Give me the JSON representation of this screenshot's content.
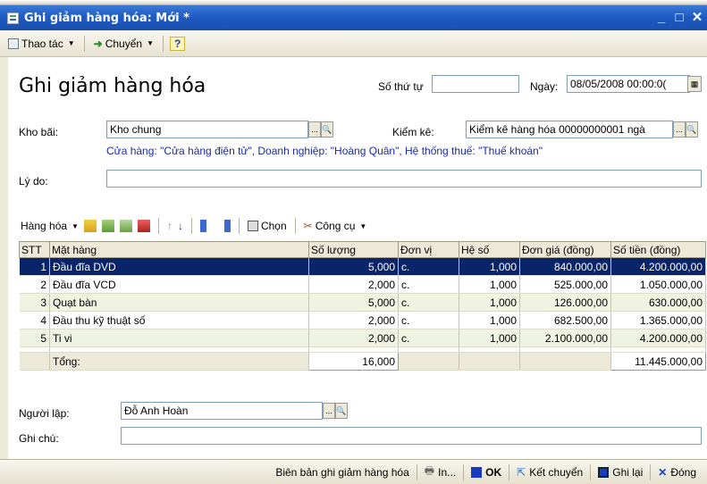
{
  "window": {
    "title": "Ghi giảm hàng hóa: Mới *",
    "minimize": "_",
    "maximize": "□",
    "close": "✕"
  },
  "toolbar": {
    "thao_tac_label": "Thao tác",
    "chuyen_label": "Chuyển",
    "help_label": "?"
  },
  "form": {
    "heading": "Ghi giảm hàng hóa",
    "so_thu_tu_label": "Số thứ tự",
    "so_thu_tu_value": "",
    "ngay_label": "Ngày:",
    "ngay_value": "08/05/2008 00:00:0(",
    "kho_bai_label": "Kho bãi:",
    "kho_bai_value": "Kho chung",
    "kiem_ke_label": "Kiểm kê:",
    "kiem_ke_value": "Kiểm kê hàng hóa 00000000001 ngà",
    "info_line": "Cửa hàng: \"Cửa hàng điện tử\", Doanh nghiệp: \"Hoàng Quân\", Hệ thống thuế: \"Thuế khoán\"",
    "ly_do_label": "Lý do:",
    "ly_do_value": "",
    "nguoi_lap_label": "Người lập:",
    "nguoi_lap_value": "Đỗ Anh Hoàn",
    "ghi_chu_label": "Ghi chú:",
    "ghi_chu_value": ""
  },
  "grid_toolbar": {
    "hang_hoa_label": "Hàng hóa",
    "chon_label": "Chọn",
    "cong_cu_label": "Công cụ"
  },
  "grid": {
    "headers": [
      "STT",
      "Mặt hàng",
      "Số lượng",
      "Đơn vị",
      "Hệ số",
      "Đơn giá (đồng)",
      "Số tiền (đồng)"
    ],
    "rows": [
      {
        "stt": "1",
        "item": "Đầu đĩa DVD",
        "qty": "5,000",
        "unit": "c.",
        "factor": "1,000",
        "price": "840.000,00",
        "amount": "4.200.000,00"
      },
      {
        "stt": "2",
        "item": "Đầu đĩa VCD",
        "qty": "2,000",
        "unit": "c.",
        "factor": "1,000",
        "price": "525.000,00",
        "amount": "1.050.000,00"
      },
      {
        "stt": "3",
        "item": "Quạt bàn",
        "qty": "5,000",
        "unit": "c.",
        "factor": "1,000",
        "price": "126.000,00",
        "amount": "630.000,00"
      },
      {
        "stt": "4",
        "item": "Đầu thu kỹ thuật số",
        "qty": "2,000",
        "unit": "c.",
        "factor": "1,000",
        "price": "682.500,00",
        "amount": "1.365.000,00"
      },
      {
        "stt": "5",
        "item": "Ti vi",
        "qty": "2,000",
        "unit": "c.",
        "factor": "1,000",
        "price": "2.100.000,00",
        "amount": "4.200.000,00"
      }
    ],
    "total_label": "Tổng:",
    "total_qty": "16,000",
    "total_amount": "11.445.000,00"
  },
  "statusbar": {
    "report_label": "Biên bản ghi giảm hàng hóa",
    "print_label": "In...",
    "ok_label": "OK",
    "transfer_label": "Kết chuyển",
    "save_label": "Ghi lại",
    "close_label": "Đóng"
  },
  "colors": {
    "titlebar": "#1f5cc4",
    "selection": "#0a246a",
    "info_text": "#1a2aa8"
  }
}
